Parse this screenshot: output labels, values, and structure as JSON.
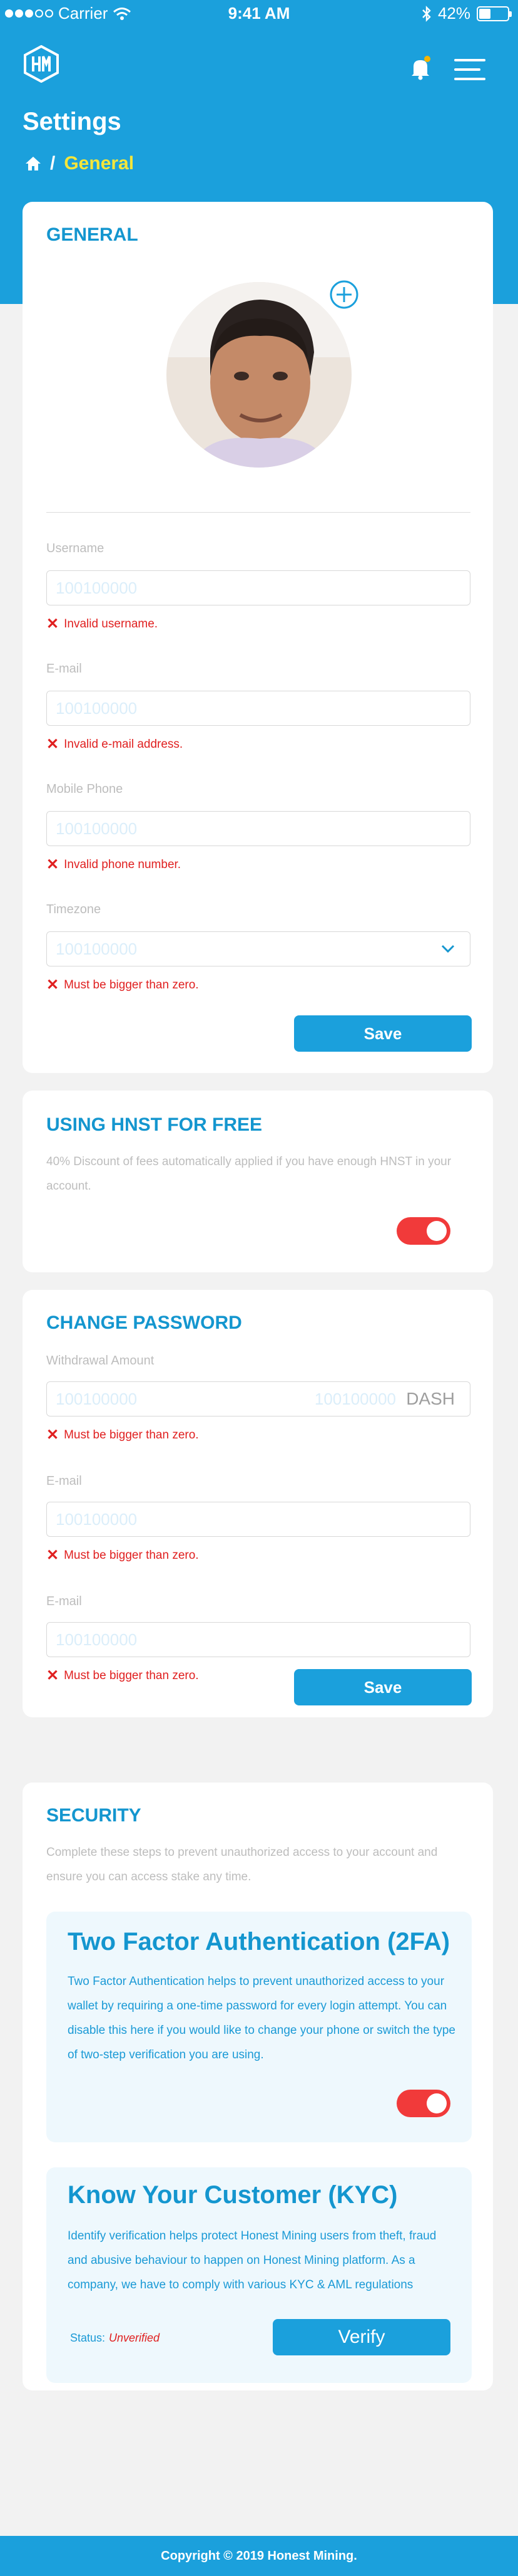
{
  "statusbar": {
    "carrier": "Carrier",
    "time": "9:41 AM",
    "battery": "42%",
    "battery_level": 0.42
  },
  "header": {
    "title": "Settings",
    "breadcrumb_separator": "/",
    "breadcrumb_current": "General"
  },
  "general": {
    "title": "GENERAL",
    "fields": [
      {
        "label": "Username",
        "placeholder": "100100000",
        "error": "Invalid username."
      },
      {
        "label": "E-mail",
        "placeholder": "100100000",
        "error": "Invalid e-mail address."
      },
      {
        "label": "Mobile Phone",
        "placeholder": "100100000",
        "error": "Invalid phone number."
      },
      {
        "label": "Timezone",
        "placeholder": "100100000",
        "error": "Must be bigger than zero."
      }
    ],
    "save_label": "Save"
  },
  "hnst": {
    "title": "USING HNST FOR FREE",
    "description": "40% Discount of fees automatically applied if you have enough HNST in your account.",
    "toggle_on": true
  },
  "password": {
    "title": "CHANGE PASSWORD",
    "fields": [
      {
        "label": "Withdrawal Amount",
        "placeholder": "100100000",
        "value_hint": "100100000",
        "unit": "DASH",
        "error": "Must be bigger than zero."
      },
      {
        "label": "E-mail",
        "placeholder": "100100000",
        "error": "Must be bigger than zero."
      },
      {
        "label": "E-mail",
        "placeholder": "100100000",
        "error": "Must be bigger than zero."
      }
    ],
    "save_label": "Save"
  },
  "security": {
    "title": "SECURITY",
    "description": "Complete these steps to prevent unauthorized access to your account and ensure you can access stake any time.",
    "twofa": {
      "title": "Two Factor Authentication (2FA)",
      "text": "Two Factor Authentication helps to prevent unauthorized access to your wallet by requiring a one-time password for every login attempt. You can disable this here if you would like to change your phone or switch the type of two-step verification you are using.",
      "toggle_on": true
    },
    "kyc": {
      "title": "Know Your Customer (KYC)",
      "text": "Identify verification helps protect Honest Mining users  from theft, fraud and abusive behaviour to happen on Honest Mining platform. As a company, we have to comply with various KYC &  AML regulations",
      "status_label": "Status:",
      "status_value": "Unverified",
      "verify_label": "Verify"
    }
  },
  "footer": {
    "copyright": "Copyright © 2019 Honest Mining."
  },
  "colors": {
    "brand": "#1ba0dc",
    "error": "#e02020",
    "toggle": "#f13a3a",
    "breadcrumb_active": "#f5e63a"
  }
}
